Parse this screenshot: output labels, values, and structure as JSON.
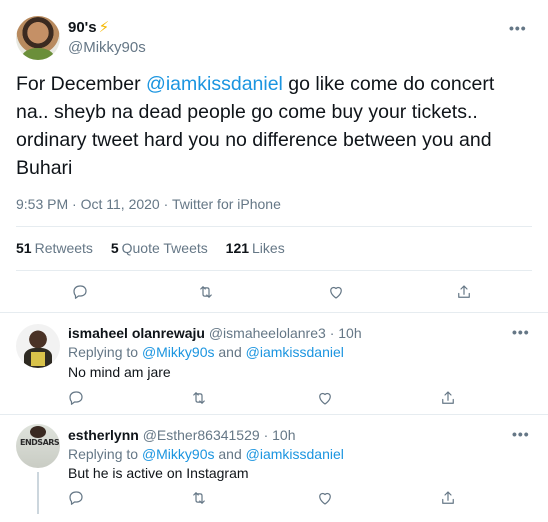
{
  "main_tweet": {
    "display_name": "90's",
    "name_emoji": "⚡",
    "handle": "@Mikky90s",
    "text_before": "For December ",
    "mention": "@iamkissdaniel",
    "text_after": " go like come do concert na.. sheyb na dead people go come buy your tickets.. ordinary tweet hard you no difference between you and Buhari",
    "time": "9:53 PM",
    "date": "Oct 11, 2020",
    "source": "Twitter for iPhone",
    "retweets_count": "51",
    "retweets_label": "Retweets",
    "quotes_count": "5",
    "quotes_label": "Quote Tweets",
    "likes_count": "121",
    "likes_label": "Likes",
    "more_label": "•••"
  },
  "replies": [
    {
      "display_name": "ismaheel olanrewaju",
      "handle": "@ismaheelolanre3",
      "time": "10h",
      "replying_prefix": "Replying to ",
      "replying_user1": "@Mikky90s",
      "replying_and": " and ",
      "replying_user2": "@iamkissdaniel",
      "text": "No mind am jare",
      "more_label": "•••"
    },
    {
      "display_name": "estherlynn",
      "handle": "@Esther86341529",
      "time": "10h",
      "replying_prefix": "Replying to ",
      "replying_user1": "@Mikky90s",
      "replying_and": " and ",
      "replying_user2": "@iamkissdaniel",
      "text": "But he is active on Instagram",
      "more_label": "•••"
    }
  ],
  "icons": {
    "reply": "reply-icon",
    "retweet": "retweet-icon",
    "like": "like-icon",
    "share": "share-icon"
  },
  "colors": {
    "link": "#1b95e0",
    "secondary": "#657786",
    "divider": "#e6ecf0",
    "bolt": "#f5b800"
  }
}
